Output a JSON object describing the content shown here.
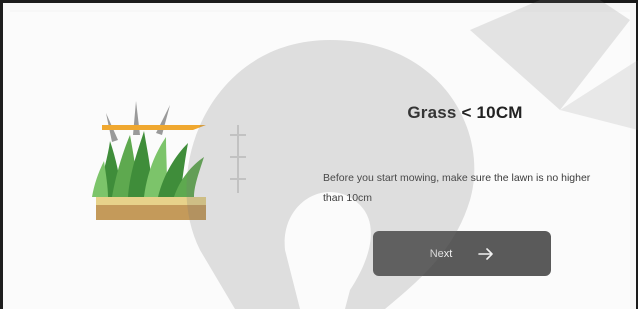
{
  "dialog": {
    "title": "Grass < 10CM",
    "description": "Before you start mowing, make sure the lawn is no higher than 10cm",
    "next_label": "Next"
  },
  "icons": {
    "illustration": "grass-illustration",
    "next_arrow": "arrow-right-icon",
    "watermark": "brand-watermark-logo"
  },
  "colors": {
    "button_bg": "#5a5a5a",
    "grass_dark": "#3f8d3a",
    "grass_light": "#7cc46a",
    "soil": "#c49a5a",
    "accent_orange": "#f0a830"
  }
}
